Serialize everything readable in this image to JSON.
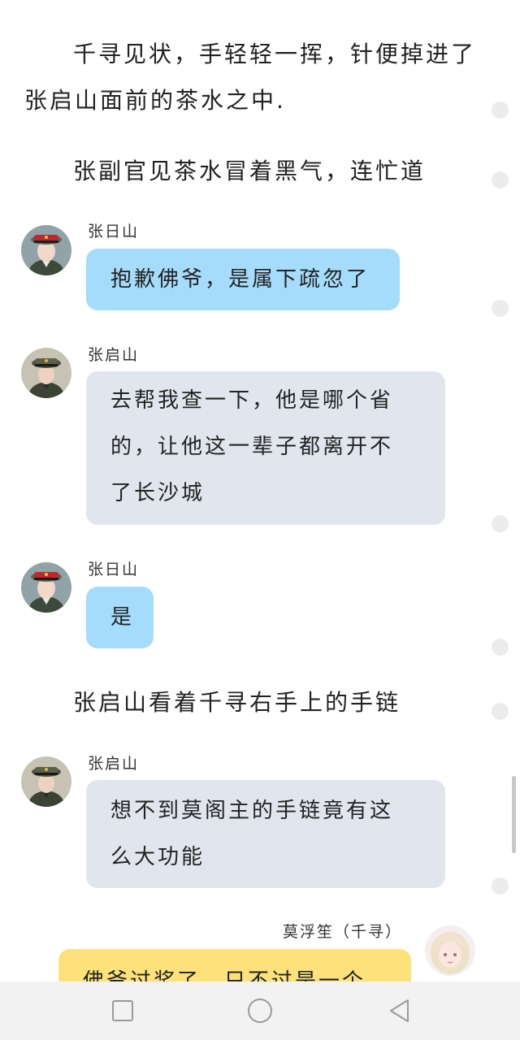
{
  "narration": [
    "千寻见状，手轻轻一挥，针便掉进了",
    "张启山面前的茶水之中.",
    "张副官见茶水冒着黑气，连忙道",
    "张启山看着千寻右手上的手链"
  ],
  "messages": [
    {
      "sender": "张日山",
      "lines": [
        "抱歉佛爷，是属下疏忽了"
      ]
    },
    {
      "sender": "张启山",
      "lines": [
        "去帮我查一下，他是哪个省",
        "的，让他这一辈子都离开不",
        "了长沙城"
      ]
    },
    {
      "sender": "张日山",
      "lines": [
        "是"
      ]
    },
    {
      "sender": "张启山",
      "lines": [
        "想不到莫阁主的手链竟有这",
        "么大功能"
      ]
    },
    {
      "sender": "莫浮笙（千寻）",
      "lines": [
        "佛爷过奖了，只不过是一个"
      ]
    }
  ],
  "icons": {
    "avatar_zhang_rishan": "officer-red-cap-avatar",
    "avatar_zhang_qishan": "officer-dark-cap-avatar",
    "avatar_mo_fusheng": "blonde-girl-avatar",
    "nav_recent": "square-recent-apps-icon",
    "nav_home": "circle-home-icon",
    "nav_back": "triangle-back-icon"
  },
  "colors": {
    "bubble_blue": "#a6dcfb",
    "bubble_gray": "#e1e6ee",
    "bubble_yellow": "#fde27b",
    "navbar": "#f2f2f2"
  }
}
